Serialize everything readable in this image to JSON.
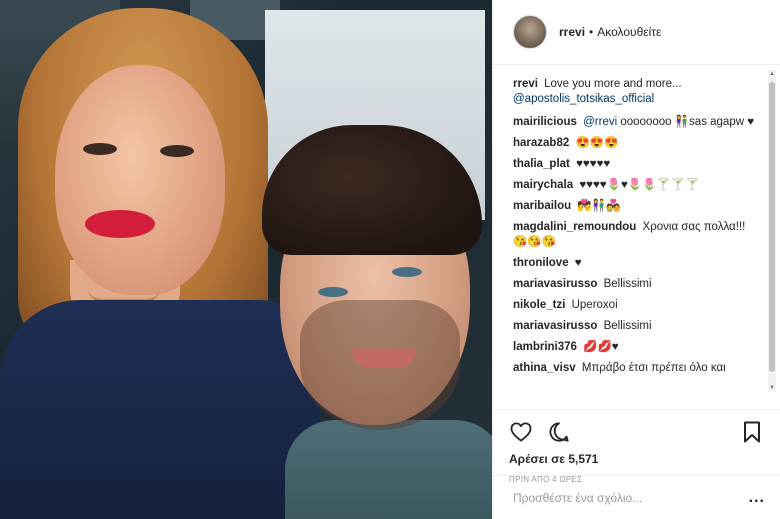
{
  "header": {
    "username": "rrevi",
    "separator": "•",
    "follow_status": "Ακολουθείτε"
  },
  "caption": {
    "user": "rrevi",
    "text": "Love you more and more...",
    "mention": "@apostolis_totsikas_official"
  },
  "comments": [
    {
      "user": "mairilicious",
      "mention": "@rrevi",
      "text": "oooooooo 👫sas agapw ♥"
    },
    {
      "user": "harazab82",
      "mention": "",
      "text": "😍😍😍"
    },
    {
      "user": "thalia_plat",
      "mention": "",
      "text": "♥♥♥♥♥"
    },
    {
      "user": "mairychala",
      "mention": "",
      "text": "♥♥♥♥🌷♥🌷🌷🍸🍸🍸"
    },
    {
      "user": "maribailou",
      "mention": "",
      "text": "💏👫💑"
    },
    {
      "user": "magdalini_remoundou",
      "mention": "",
      "text": "Χρονια σας πολλα!!!😘😘😘"
    },
    {
      "user": "thronilove",
      "mention": "",
      "text": "♥"
    },
    {
      "user": "mariavasirusso",
      "mention": "",
      "text": "Bellissimi"
    },
    {
      "user": "nikole_tzi",
      "mention": "",
      "text": "Uperoxoi"
    },
    {
      "user": "mariavasirusso",
      "mention": "",
      "text": "Bellissimi"
    },
    {
      "user": "lambrini376",
      "mention": "",
      "text": "💋💋♥"
    },
    {
      "user": "athina_visv",
      "mention": "",
      "text": "Μπράβο έτσι πρέπει όλο και"
    }
  ],
  "actions": {
    "like_icon": "heart-outline-icon",
    "comment_icon": "comment-bubble-icon",
    "save_icon": "bookmark-icon",
    "likes_text": "Αρέσει σε 5,571",
    "timestamp": "ΠΡΙΝ ΑΠΟ 4 ΩΡΕΣ"
  },
  "add_comment": {
    "placeholder": "Προσθέστε ένα σχόλιο...",
    "more_label": "..."
  }
}
